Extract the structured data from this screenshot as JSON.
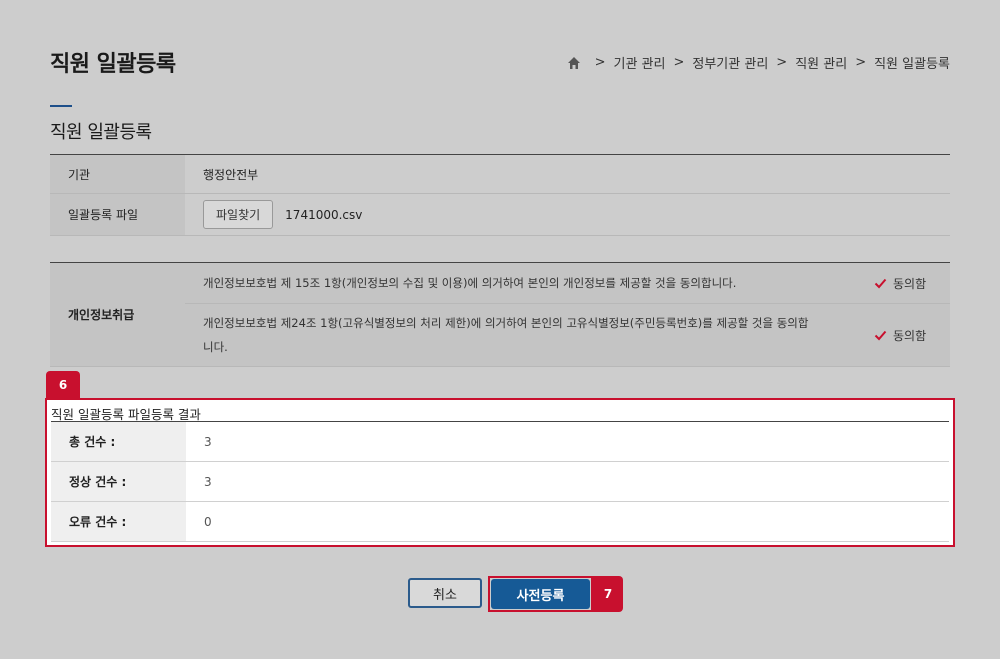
{
  "page": {
    "title": "직원 일괄등록"
  },
  "breadcrumb": {
    "items": [
      "기관 관리",
      "정부기관 관리",
      "직원 관리",
      "직원 일괄등록"
    ],
    "separator": ">"
  },
  "section": {
    "title": "직원 일괄등록"
  },
  "form": {
    "org_label": "기관",
    "org_value": "행정안전부",
    "file_label": "일괄등록 파일",
    "file_button": "파일찾기",
    "file_name": "1741000.csv"
  },
  "agreement": {
    "label": "개인정보취급",
    "items": [
      {
        "text": "개인정보보호법 제 15조 1항(개인정보의 수집 및 이용)에 의거하여 본인의 개인정보를 제공할 것을 동의합니다.",
        "check_label": "동의함",
        "checked": true
      },
      {
        "text": "개인정보보호법 제24조 1항(고유식별정보의 처리 제한)에 의거하여 본인의 고유식별정보(주민등록번호)를 제공할 것을 동의합니다.",
        "check_label": "동의함",
        "checked": true
      }
    ]
  },
  "result": {
    "badge": "6",
    "title": "직원 일괄등록 파일등록 결과",
    "rows": [
      {
        "label": "총 건수 :",
        "value": "3"
      },
      {
        "label": "정상 건수 :",
        "value": "3"
      },
      {
        "label": "오류 건수 :",
        "value": "0"
      }
    ]
  },
  "actions": {
    "cancel_label": "취소",
    "submit_label": "사전등록",
    "submit_badge": "7"
  },
  "colors": {
    "accent": "#c8102e",
    "primary": "#165a96",
    "background": "#cdcdcd"
  },
  "icons": {
    "home": "home-icon",
    "check": "check-icon"
  }
}
